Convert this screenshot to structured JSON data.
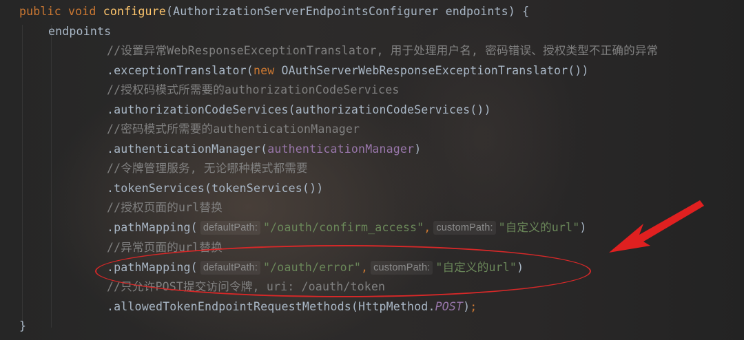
{
  "code": {
    "l1": {
      "kw1": "public",
      "kw2": "void",
      "fn": "configure",
      "rest": "(AuthorizationServerEndpointsConfigurer endpoints) {"
    },
    "l2": {
      "text": "endpoints"
    },
    "l3": {
      "comment": "//设置异常WebResponseExceptionTranslator, 用于处理用户名, 密码错误、授权类型不正确的异常"
    },
    "l4": {
      "pre": ".exceptionTranslator(",
      "kw": "new",
      "post": " OAuthServerWebResponseExceptionTranslator())"
    },
    "l5": {
      "comment": "//授权码模式所需要的authorizationCodeServices"
    },
    "l6": {
      "text": ".authorizationCodeServices(authorizationCodeServices())"
    },
    "l7": {
      "comment": "//密码模式所需要的authenticationManager"
    },
    "l8": {
      "pre": ".authenticationManager(",
      "field": "authenticationManager",
      "post": ")"
    },
    "l9": {
      "comment": "//令牌管理服务, 无论哪种模式都需要"
    },
    "l10": {
      "text": ".tokenServices(tokenServices())"
    },
    "l11": {
      "comment": "//授权页面的url替换"
    },
    "l12": {
      "pre": ".pathMapping(",
      "hint1": "defaultPath:",
      "str1": "\"/oauth/confirm_access\"",
      "comma": ",",
      "hint2": "customPath:",
      "str2": "\"自定义的url\"",
      "post": ")"
    },
    "l13": {
      "comment": "//异常页面的url替换"
    },
    "l14": {
      "pre": ".pathMapping(",
      "hint1": "defaultPath:",
      "str1": "\"/oauth/error\"",
      "comma": ",",
      "hint2": "customPath:",
      "str2": "\"自定义的url\"",
      "post": ")"
    },
    "l15": {
      "comment": "//只允许POST提交访问令牌, uri: /oauth/token"
    },
    "l16": {
      "pre": ".allowedTokenEndpointRequestMethods(HttpMethod.",
      "field": "POST",
      "post": ")",
      "semi": ";"
    },
    "l17": {
      "text": "}"
    }
  },
  "colors": {
    "keyword": "#cc7832",
    "method": "#ffc66d",
    "string": "#6a8759",
    "comment": "#808080",
    "field": "#9876aa",
    "annotation_red": "#d62828"
  }
}
